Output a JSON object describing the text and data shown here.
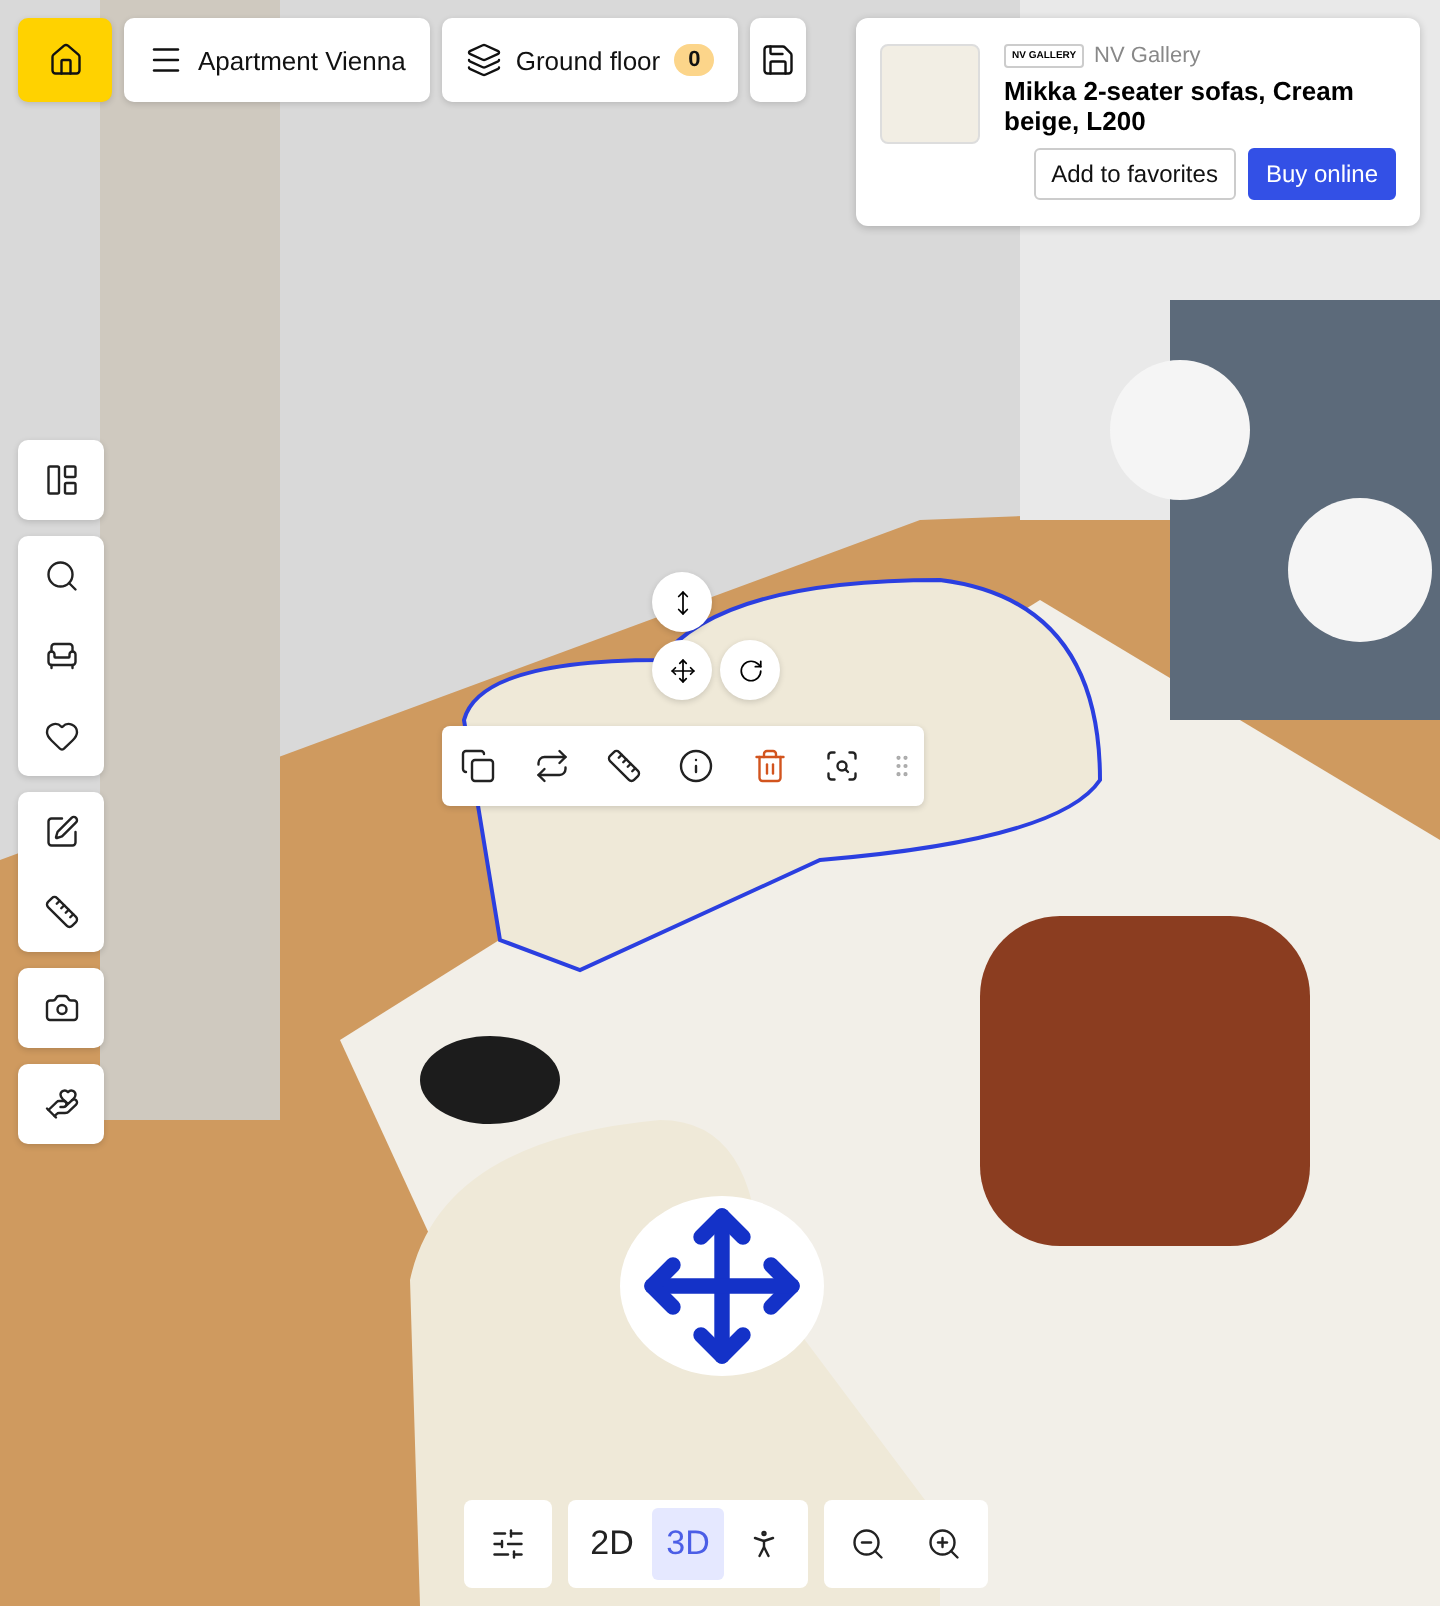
{
  "header": {
    "project": "Apartment Vienna",
    "floor": {
      "label": "Ground floor",
      "count": "0"
    }
  },
  "product": {
    "brand_logo": "NV GALLERY",
    "brand": "NV Gallery",
    "title": "Mikka 2-seater sofas, Cream beige, L200",
    "buttons": [
      "Add to favorites",
      "Buy online"
    ]
  },
  "view_modes": [
    {
      "label": "2D",
      "selected": false
    },
    {
      "label": "3D",
      "selected": true
    }
  ]
}
